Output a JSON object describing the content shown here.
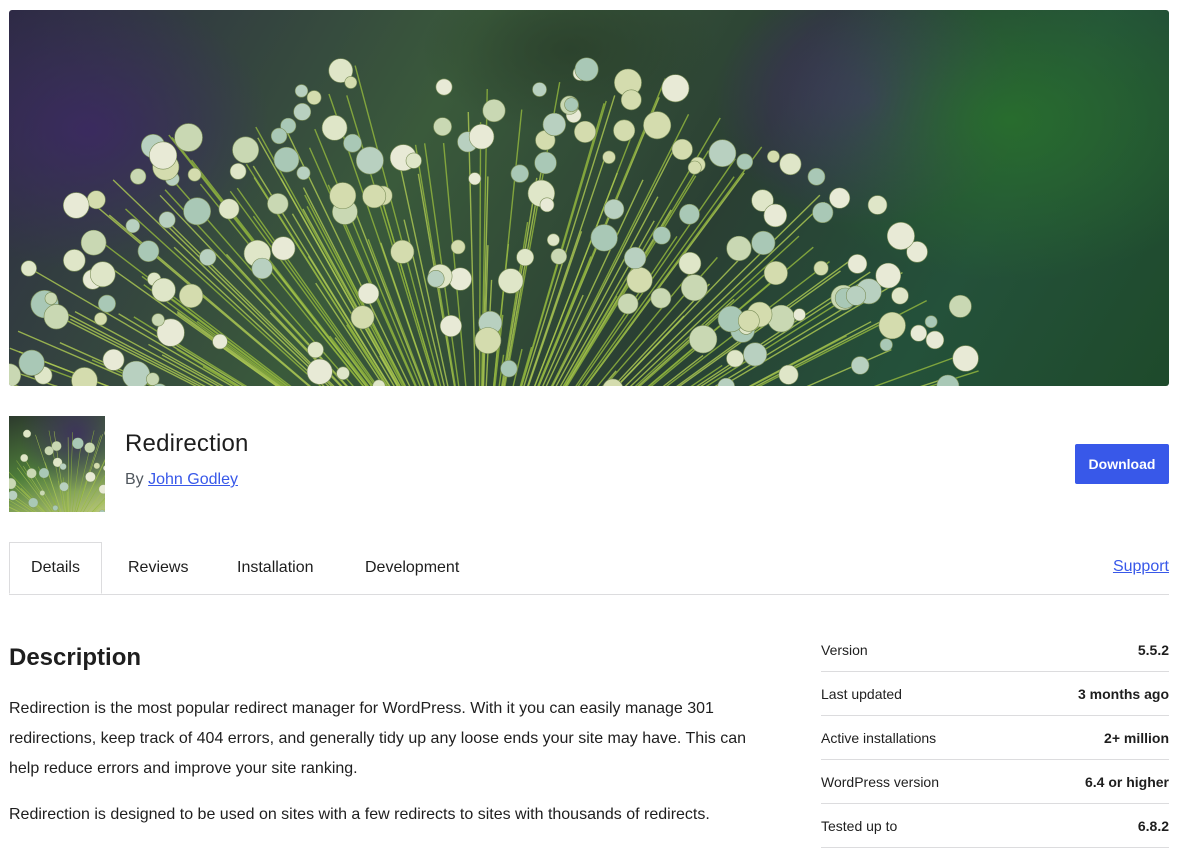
{
  "plugin": {
    "name": "Redirection",
    "by_label": "By",
    "author": "John Godley",
    "download_label": "Download"
  },
  "tabs": {
    "items": [
      "Details",
      "Reviews",
      "Installation",
      "Development"
    ],
    "active": "Details",
    "support_label": "Support"
  },
  "description": {
    "heading": "Description",
    "paragraph1": "Redirection is the most popular redirect manager for WordPress. With it you can easily manage 301 redirections, keep track of 404 errors, and generally tidy up any loose ends your site may have. This can help reduce errors and improve your site ranking.",
    "paragraph2": "Redirection is designed to be used on sites with a few redirects to sites with thousands of redirects."
  },
  "meta": [
    {
      "label": "Version",
      "value": "5.5.2"
    },
    {
      "label": "Last updated",
      "value": "3 months ago"
    },
    {
      "label": "Active installations",
      "value": "2+ million"
    },
    {
      "label": "WordPress version",
      "value": "6.4 or higher"
    },
    {
      "label": "Tested up to",
      "value": "6.8.2"
    }
  ],
  "colors": {
    "accent": "#3858e9",
    "border": "#dcdcde",
    "text": "#1e1e1e"
  }
}
